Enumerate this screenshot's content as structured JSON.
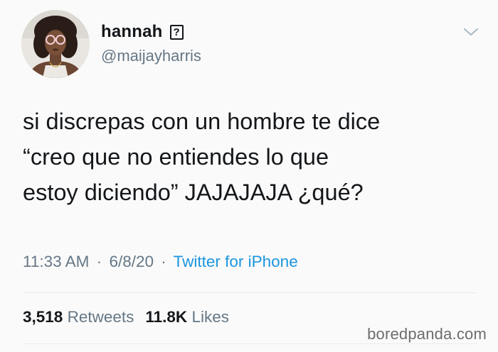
{
  "user": {
    "display_name": "hannah",
    "emoji_placeholder": "?",
    "handle": "@maijayharris"
  },
  "tweet": {
    "text": "si discrepas con un hombre te dice\n“creo que no entiendes lo que\nestoy diciendo” JAJAJAJA ¿qué?",
    "time": "11:33 AM",
    "date": "6/8/20",
    "separator": "·",
    "source": "Twitter for iPhone"
  },
  "stats": {
    "retweets_count": "3,518",
    "retweets_label": "Retweets",
    "likes_count": "11.8K",
    "likes_label": "Likes"
  },
  "watermark": "boredpanda.com",
  "icons": {
    "menu": "chevron-down-icon",
    "emoji": "unknown-emoji-icon"
  },
  "colors": {
    "background": "#fafafa",
    "text": "#14171a",
    "secondary": "#657786",
    "link": "#1b95e0"
  }
}
